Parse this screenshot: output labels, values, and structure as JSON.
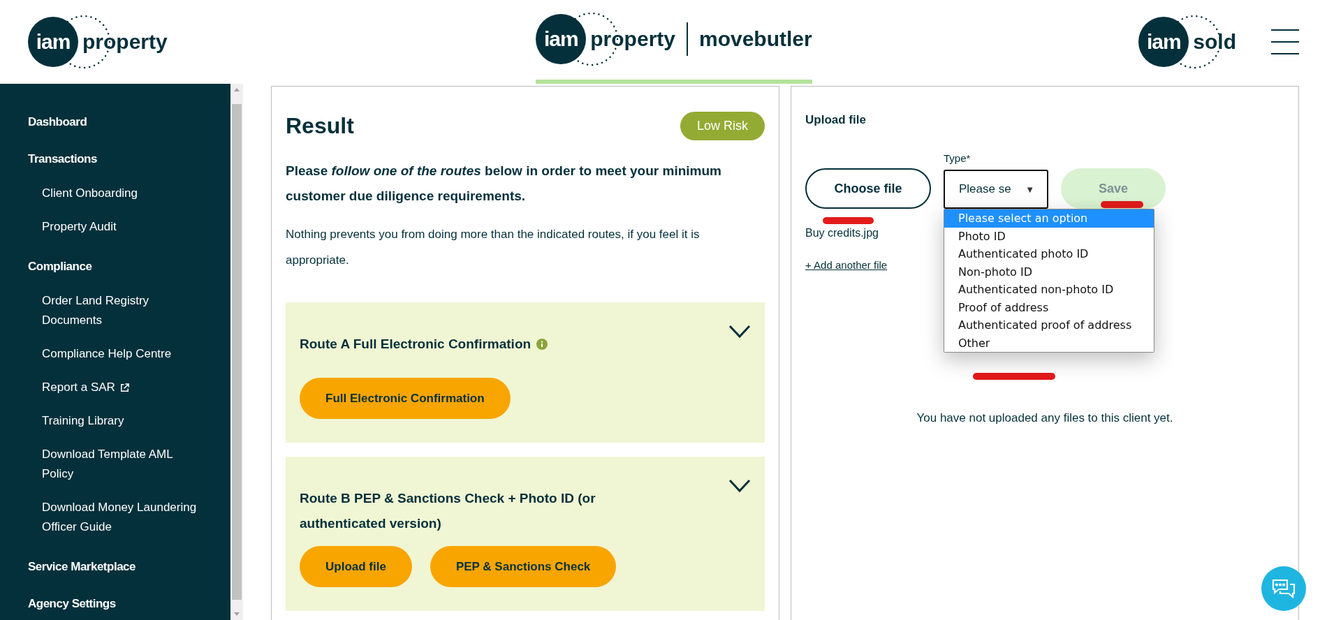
{
  "header": {
    "left_logo": {
      "mark": "iam",
      "word": "property"
    },
    "center_logo": {
      "mark": "iam",
      "word": "property",
      "partner": "movebutler",
      "selected": true
    },
    "right_logo": {
      "mark": "iam",
      "word": "sold"
    }
  },
  "sidebar": {
    "items": [
      {
        "label": "Dashboard"
      },
      {
        "label": "Transactions",
        "children": [
          {
            "label": "Client Onboarding",
            "external": false
          },
          {
            "label": "Property Audit",
            "external": false
          }
        ]
      },
      {
        "label": "Compliance",
        "children": [
          {
            "label": "Order Land Registry Documents",
            "external": false
          },
          {
            "label": "Compliance Help Centre",
            "external": false
          },
          {
            "label": "Report a SAR",
            "external": true
          },
          {
            "label": "Training Library",
            "external": false
          },
          {
            "label": "Download Template AML Policy",
            "external": false
          },
          {
            "label": "Download Money Laundering Officer Guide",
            "external": false
          }
        ]
      },
      {
        "label": "Service Marketplace"
      },
      {
        "label": "Agency Settings"
      }
    ]
  },
  "result": {
    "title": "Result",
    "risk": "Low Risk",
    "instruction": "Please *follow one of the routes* below in order to meet your minimum customer due diligence requirements.",
    "note": "Nothing prevents you from doing more than the indicated routes, if you feel it is appropriate.",
    "routes": [
      {
        "title": "Route A Full Electronic Confirmation",
        "info": true,
        "expanded": false,
        "buttons": [
          "Full Electronic Confirmation"
        ]
      },
      {
        "title": "Route B PEP & Sanctions Check + Photo ID (or authenticated version)",
        "info": false,
        "expanded": false,
        "buttons": [
          "Upload file",
          "PEP & Sanctions Check"
        ]
      }
    ]
  },
  "upload": {
    "title": "Upload file",
    "choose_button": "Choose file",
    "type_label": "Type*",
    "type_value": "Please se",
    "type_caret": "▼",
    "save_button": {
      "label": "Save",
      "disabled": true
    },
    "options": [
      {
        "label": "Please select an option",
        "selected": true
      },
      {
        "label": "Photo ID",
        "selected": false
      },
      {
        "label": "Authenticated photo ID",
        "selected": false
      },
      {
        "label": "Non-photo ID",
        "selected": false
      },
      {
        "label": "Authenticated non-photo ID",
        "selected": false
      },
      {
        "label": "Proof of address",
        "selected": false
      },
      {
        "label": "Authenticated proof of address",
        "selected": false
      },
      {
        "label": "Other",
        "selected": false
      }
    ],
    "file_name": "Buy credits.jpg",
    "add_link": "+ Add another file",
    "message": "You have not uploaded any files to this client yet."
  }
}
